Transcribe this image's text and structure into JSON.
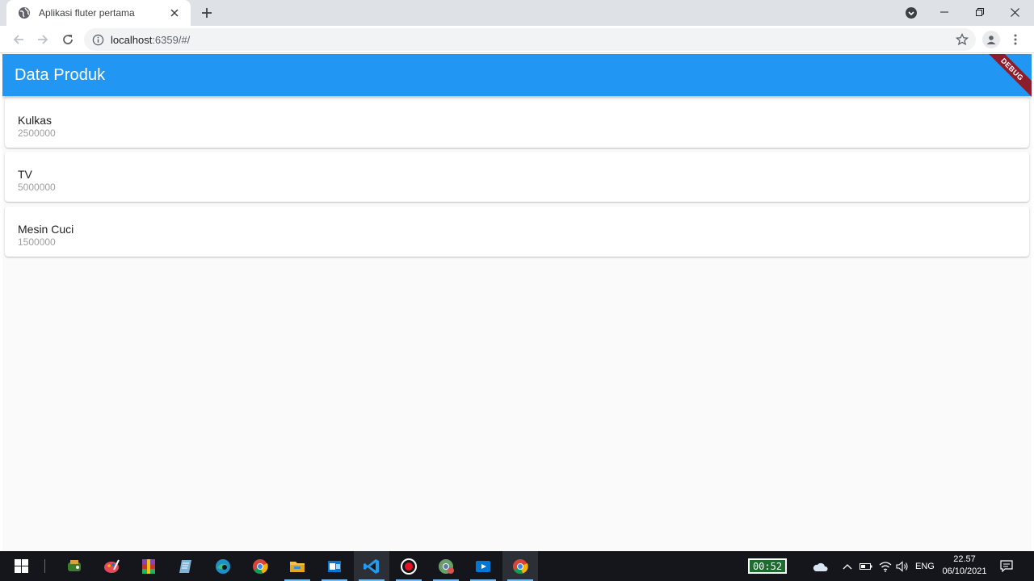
{
  "browser": {
    "tab_title": "Aplikasi fluter pertama",
    "url_host": "localhost",
    "url_rest": ":6359/#/"
  },
  "app": {
    "title": "Data Produk",
    "debug_banner": "DEBUG",
    "products": [
      {
        "name": "Kulkas",
        "price": "2500000"
      },
      {
        "name": "TV",
        "price": "5000000"
      },
      {
        "name": "Mesin Cuci",
        "price": "1500000"
      }
    ],
    "appbar_color": "#2196f3"
  },
  "taskbar": {
    "recorder_time": "00:52",
    "language": "ENG",
    "time": "22.57",
    "date": "06/10/2021",
    "apps": [
      "start-icon",
      "game-icon",
      "paint-icon",
      "winrar-icon",
      "notepad-icon",
      "edge-icon",
      "chrome-icon",
      "file-explorer-icon",
      "outlook-icon",
      "vscode-icon",
      "record-icon",
      "chrome-dev-icon",
      "media-icon",
      "chrome-active-icon"
    ]
  }
}
